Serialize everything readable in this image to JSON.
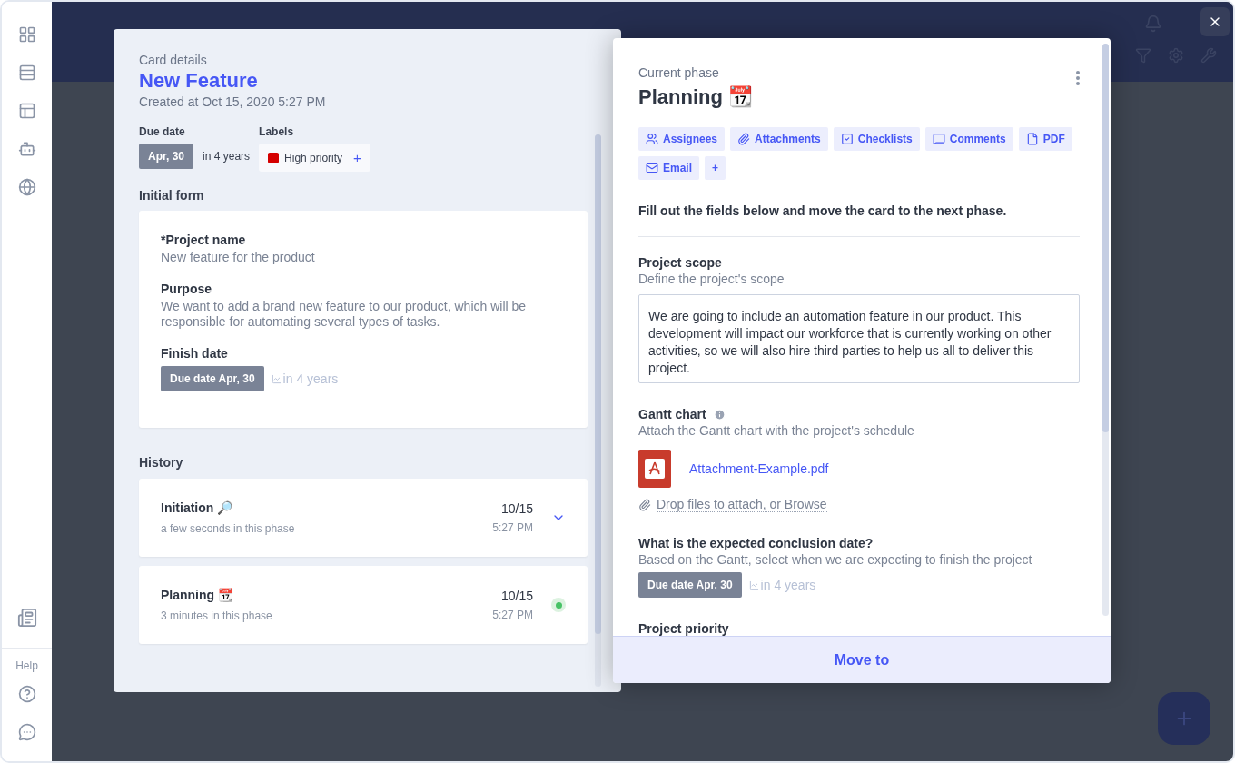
{
  "sidebar": {
    "help_label": "Help"
  },
  "card_details": {
    "eyebrow": "Card details",
    "title": "New Feature",
    "created": "Created at Oct 15, 2020 5:27 PM",
    "due_label": "Due date",
    "due_date": "Apr, 30",
    "due_relative": "in 4 years",
    "labels_label": "Labels",
    "labels": [
      {
        "name": "High priority",
        "color": "#d50000"
      }
    ],
    "add_label": "+",
    "form_title": "Initial form",
    "fields": [
      {
        "kind": "text",
        "label": "*Project name",
        "value": "New feature for the product"
      },
      {
        "kind": "text",
        "label": "Purpose",
        "value": "We want to add a brand new feature to our product, which will be responsible for automating several types of tasks."
      },
      {
        "kind": "date",
        "label": "Finish date",
        "date": "Due date Apr, 30",
        "relative": "in 4 years"
      }
    ],
    "history_title": "History",
    "history": [
      {
        "phase": "Initiation 🔎",
        "duration": "a few seconds in this phase",
        "date": "10/15",
        "time": "5:27 PM",
        "current": false
      },
      {
        "phase": "Planning 📆",
        "duration": "3 minutes in this phase",
        "date": "10/15",
        "time": "5:27 PM",
        "current": true
      }
    ]
  },
  "phase_panel": {
    "eyebrow": "Current phase",
    "title": "Planning 📆",
    "actions": [
      {
        "kind": "assignees",
        "label": "Assignees"
      },
      {
        "kind": "attachments",
        "label": "Attachments"
      },
      {
        "kind": "checklists",
        "label": "Checklists"
      },
      {
        "kind": "comments",
        "label": "Comments"
      },
      {
        "kind": "pdf",
        "label": "PDF"
      },
      {
        "kind": "email",
        "label": "Email"
      },
      {
        "kind": "add",
        "label": "+"
      }
    ],
    "instruction": "Fill out the fields below and move the card to the next phase.",
    "fields": [
      {
        "kind": "textarea",
        "label": "Project scope",
        "hint": "Define the project's scope",
        "value": "We are going to include an automation feature in our product. This development will impact our workforce that is currently working on other activities, so we will also hire third parties to help us all to deliver this project."
      },
      {
        "kind": "attachment",
        "label": "Gantt chart",
        "hint": "Attach the Gantt chart with the project's schedule",
        "file": "Attachment-Example.pdf",
        "drop": "Drop files to attach, or Browse"
      },
      {
        "kind": "date",
        "label": "What is the expected conclusion date?",
        "hint": "Based on the Gantt, select when we are expecting to finish the project",
        "date": "Due date Apr, 30",
        "relative": "in 4 years"
      },
      {
        "kind": "heading",
        "label": "Project priority"
      }
    ],
    "move_button": "Move to"
  }
}
